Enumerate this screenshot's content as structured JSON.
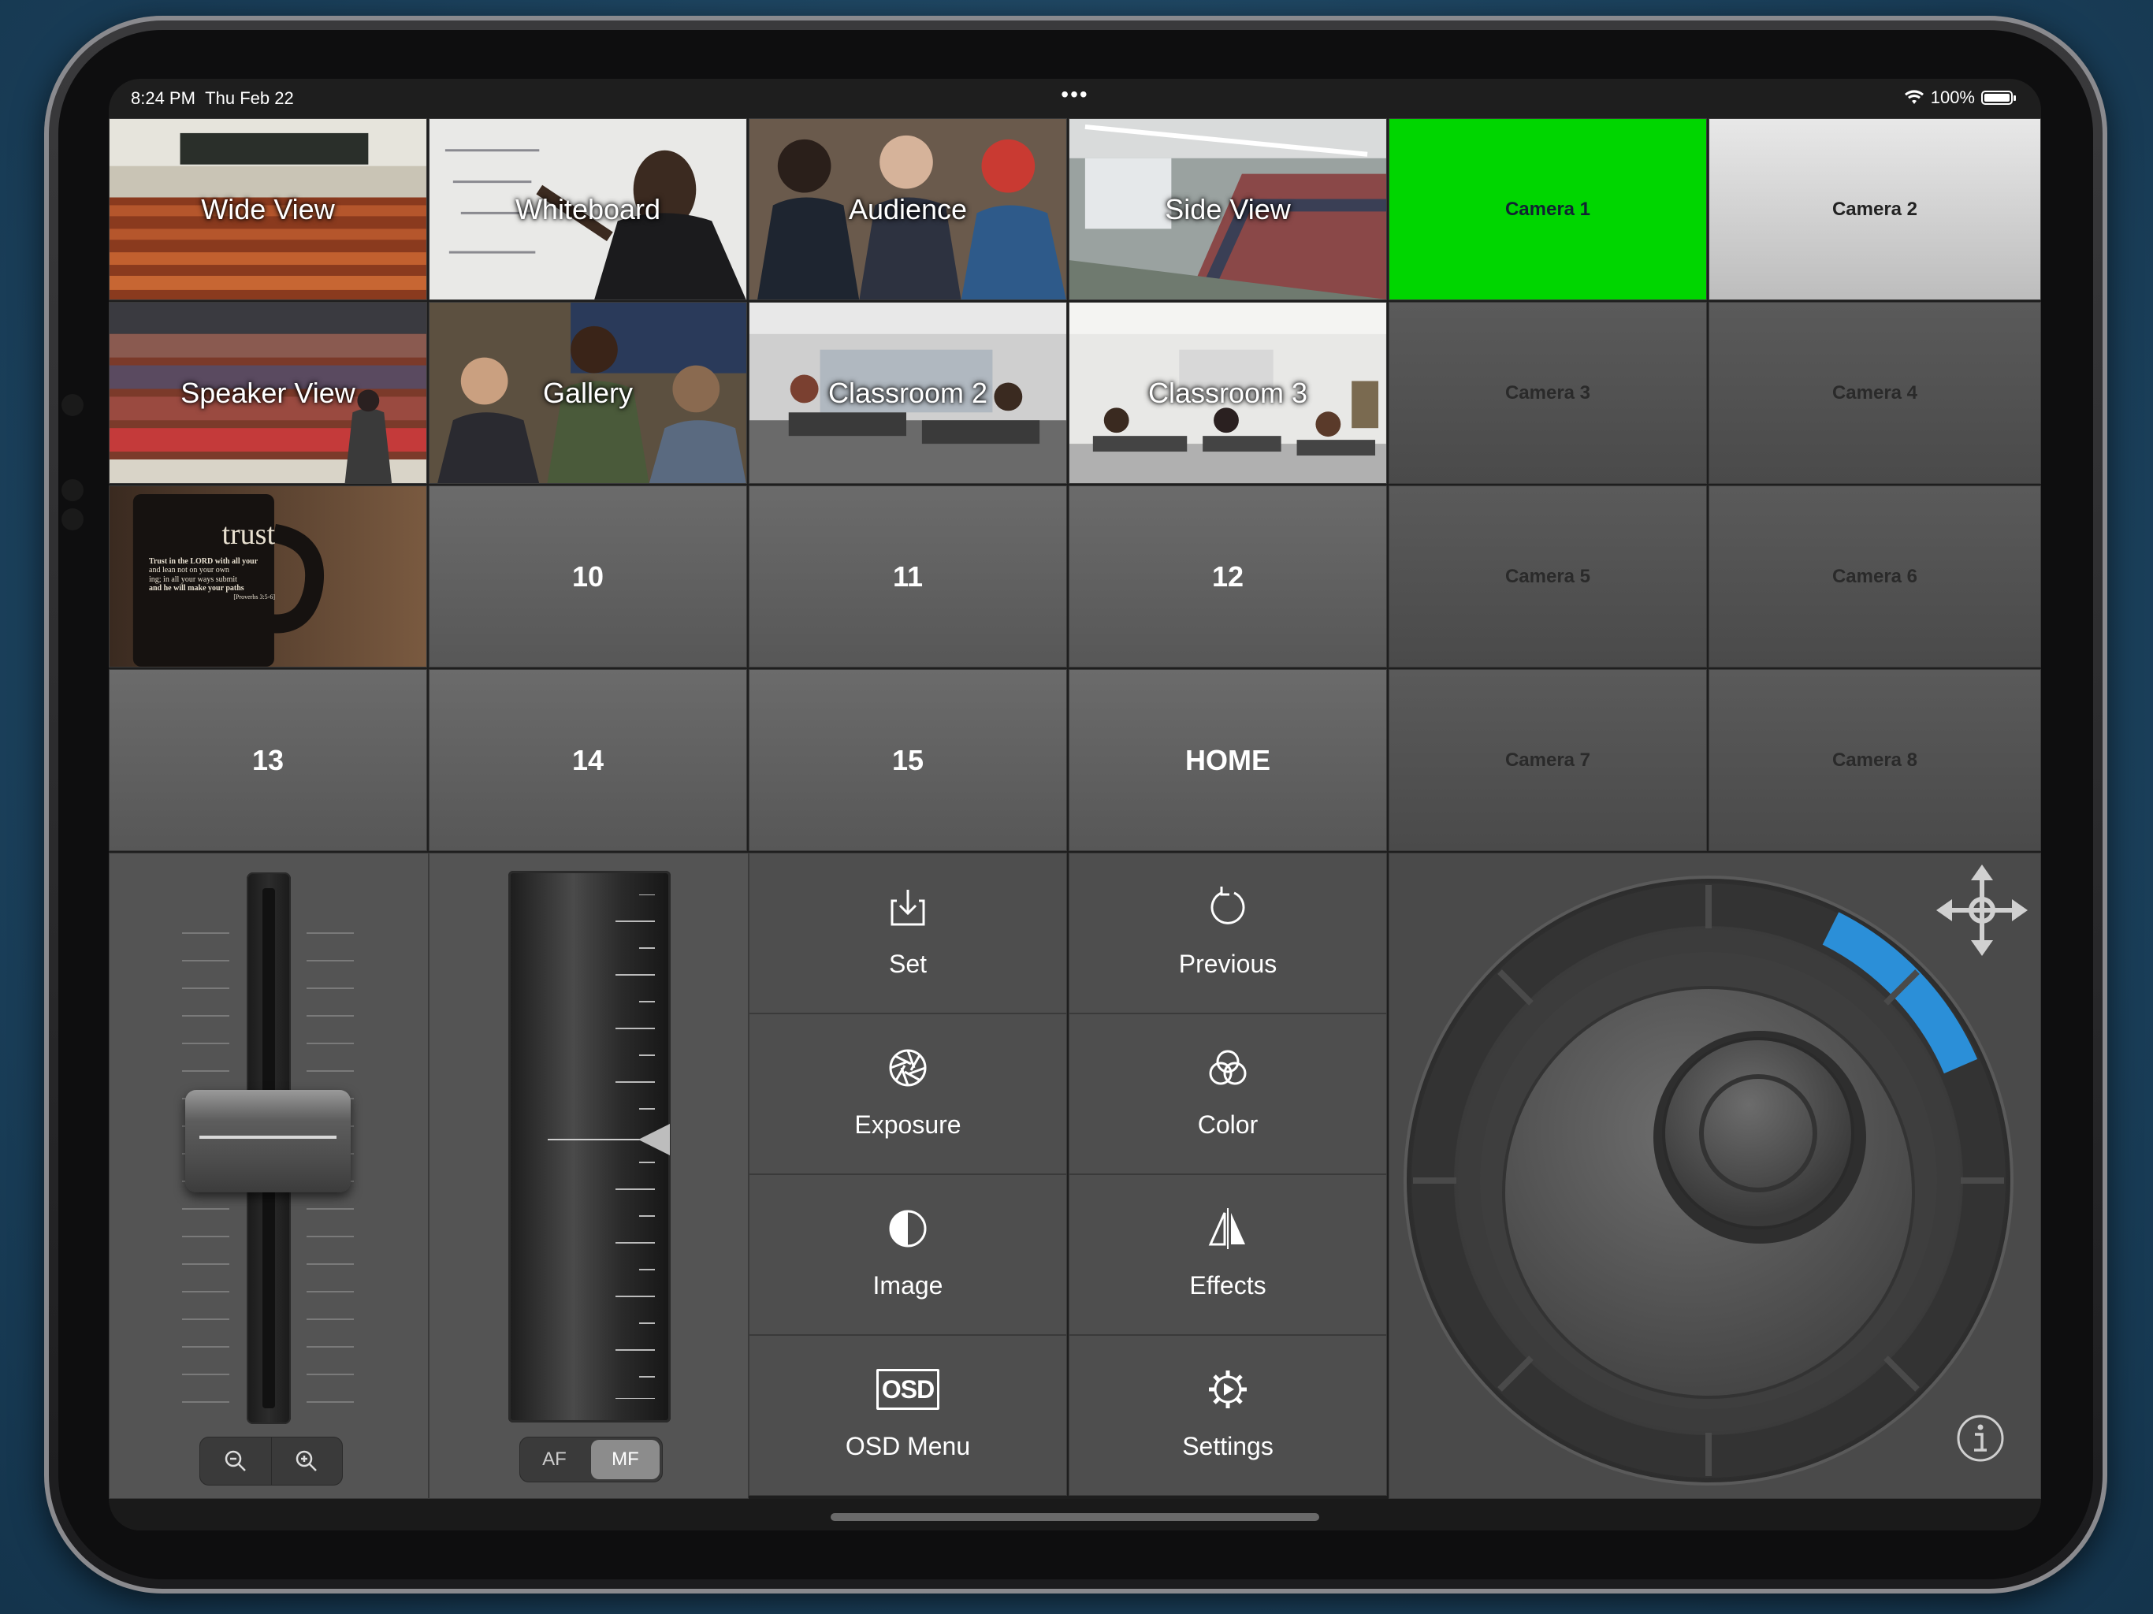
{
  "status": {
    "time": "8:24 PM",
    "date": "Thu Feb 22",
    "multitask": "•••",
    "battery": "100%"
  },
  "presets": [
    {
      "label": "Wide View"
    },
    {
      "label": "Whiteboard"
    },
    {
      "label": "Audience"
    },
    {
      "label": "Side View"
    },
    {
      "label": "Speaker View"
    },
    {
      "label": "Gallery"
    },
    {
      "label": "Classroom 2"
    },
    {
      "label": "Classroom 3"
    },
    {
      "label": "",
      "image_text": [
        "trust",
        "Trust in the LORD with all your",
        "and lean not on your own",
        "ing; in all your ways submit",
        "and he will make your paths",
        "[Proverbs 3:5-6]"
      ]
    },
    {
      "label": "10"
    },
    {
      "label": "11"
    },
    {
      "label": "12"
    },
    {
      "label": "13"
    },
    {
      "label": "14"
    },
    {
      "label": "15"
    },
    {
      "label": "HOME"
    }
  ],
  "cameras": [
    {
      "label": "Camera 1",
      "state": "active"
    },
    {
      "label": "Camera 2",
      "state": "selected"
    },
    {
      "label": "Camera 3",
      "state": "idle"
    },
    {
      "label": "Camera 4",
      "state": "idle"
    },
    {
      "label": "Camera 5",
      "state": "idle"
    },
    {
      "label": "Camera 6",
      "state": "idle"
    },
    {
      "label": "Camera 7",
      "state": "idle"
    },
    {
      "label": "Camera 8",
      "state": "idle"
    }
  ],
  "zoom": {
    "out_icon": "zoom-out-icon",
    "in_icon": "zoom-in-icon"
  },
  "focus": {
    "af_label": "AF",
    "mf_label": "MF",
    "selected": "MF"
  },
  "functions": [
    {
      "label": "Set",
      "icon": "download-tray-icon"
    },
    {
      "label": "Previous",
      "icon": "refresh-icon"
    },
    {
      "label": "Exposure",
      "icon": "aperture-icon"
    },
    {
      "label": "Color",
      "icon": "rgb-circles-icon"
    },
    {
      "label": "Image",
      "icon": "contrast-icon"
    },
    {
      "label": "Effects",
      "icon": "mirror-icon"
    },
    {
      "label": "OSD Menu",
      "icon": "osd-icon",
      "icon_text": "OSD"
    },
    {
      "label": "Settings",
      "icon": "gear-icon"
    }
  ],
  "joystick": {
    "move_icon": "move-arrows-icon",
    "info_icon": "info-icon"
  },
  "colors": {
    "active_camera": "#00d600",
    "accent_blue": "#2b8fd8"
  }
}
